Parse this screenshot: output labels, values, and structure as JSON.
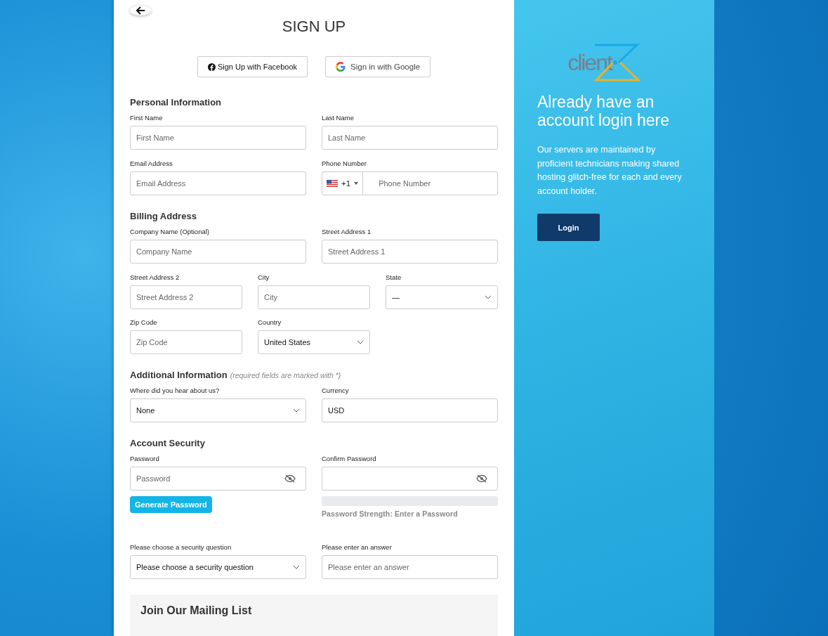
{
  "title": "SIGN UP",
  "social_buttons": [
    {
      "kind": "facebook",
      "label": "Sign Up with Facebook"
    },
    {
      "kind": "google",
      "label": "Sign in with Google"
    }
  ],
  "sections": [
    {
      "title": "Personal Information",
      "rows": [
        [
          {
            "kind": "text",
            "label": "First Name",
            "placeholder": "First Name"
          },
          {
            "kind": "text",
            "label": "Last Name",
            "placeholder": "Last Name"
          }
        ],
        [
          {
            "kind": "text",
            "label": "Email Address",
            "placeholder": "Email Address"
          },
          {
            "kind": "phone",
            "label": "Phone Number",
            "dial_code": "+1",
            "placeholder": "Phone Number"
          }
        ]
      ]
    },
    {
      "title": "Billing Address",
      "rows": [
        [
          {
            "kind": "text",
            "label": "Company Name (Optional)",
            "placeholder": "Company Name"
          },
          {
            "kind": "text",
            "label": "Street Address 1",
            "placeholder": "Street Address 1"
          }
        ],
        [
          {
            "kind": "text",
            "label": "Street Address 2",
            "placeholder": "Street Address 2"
          },
          {
            "kind": "text",
            "label": "City",
            "placeholder": "City"
          },
          {
            "kind": "select",
            "label": "State",
            "value": "—"
          },
          {
            "kind": "text",
            "label": "Zip Code",
            "placeholder": "Zip Code"
          },
          {
            "kind": "select",
            "label": "Country",
            "value": "United States"
          }
        ]
      ]
    },
    {
      "title": "Additional Information",
      "note": "(required fields are marked with *)",
      "rows": [
        [
          {
            "kind": "select",
            "label": "Where did you hear about us?",
            "value": "None"
          },
          {
            "kind": "text",
            "label": "Currency",
            "value": "USD"
          }
        ]
      ]
    },
    {
      "title": "Account Security",
      "rows": [
        [
          {
            "kind": "password",
            "label": "Password",
            "placeholder": "Password"
          },
          {
            "kind": "password",
            "label": "Confirm Password"
          }
        ]
      ],
      "generate_button": "Generate Password",
      "strength": {
        "level": 0,
        "text": "Password Strength: Enter a Password"
      },
      "rows_after": [
        [
          {
            "kind": "select",
            "label": "Please choose a security question",
            "value": "Please choose a security question"
          },
          {
            "kind": "text",
            "label": "Please enter an answer",
            "placeholder": "Please enter an answer"
          }
        ]
      ]
    }
  ],
  "mailing_list": {
    "title": "Join Our Mailing List"
  },
  "side_panel": {
    "logo_text": "client",
    "heading": "Already have an account login here",
    "text": "Our servers are maintained by proficient technicians making shared hosting glitch-free for each and every account holder.",
    "button": "Login"
  }
}
